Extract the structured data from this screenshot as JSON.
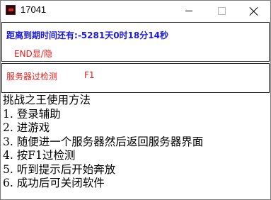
{
  "window": {
    "title": "17041",
    "icon": "app-icon"
  },
  "countdown": {
    "label": "距离到期时间还有:",
    "value": "-5281天0时18分14秒"
  },
  "toggle": {
    "label": "END显/隐"
  },
  "check": {
    "label": "服务器过检测",
    "hotkey": "F1"
  },
  "instructions": {
    "heading": "挑战之王使用方法",
    "steps": [
      "1. 登录辅助",
      "2. 进游戏",
      "3. 随便进一个服务器然后返回服务器界面",
      "4. 按F1过检测",
      "5. 听到提示后开始奔放",
      "6. 成功后可关闭软件"
    ]
  },
  "colors": {
    "countdown_text": "#1c1cd8",
    "accent_red": "#e41c1c",
    "border": "#222222"
  }
}
